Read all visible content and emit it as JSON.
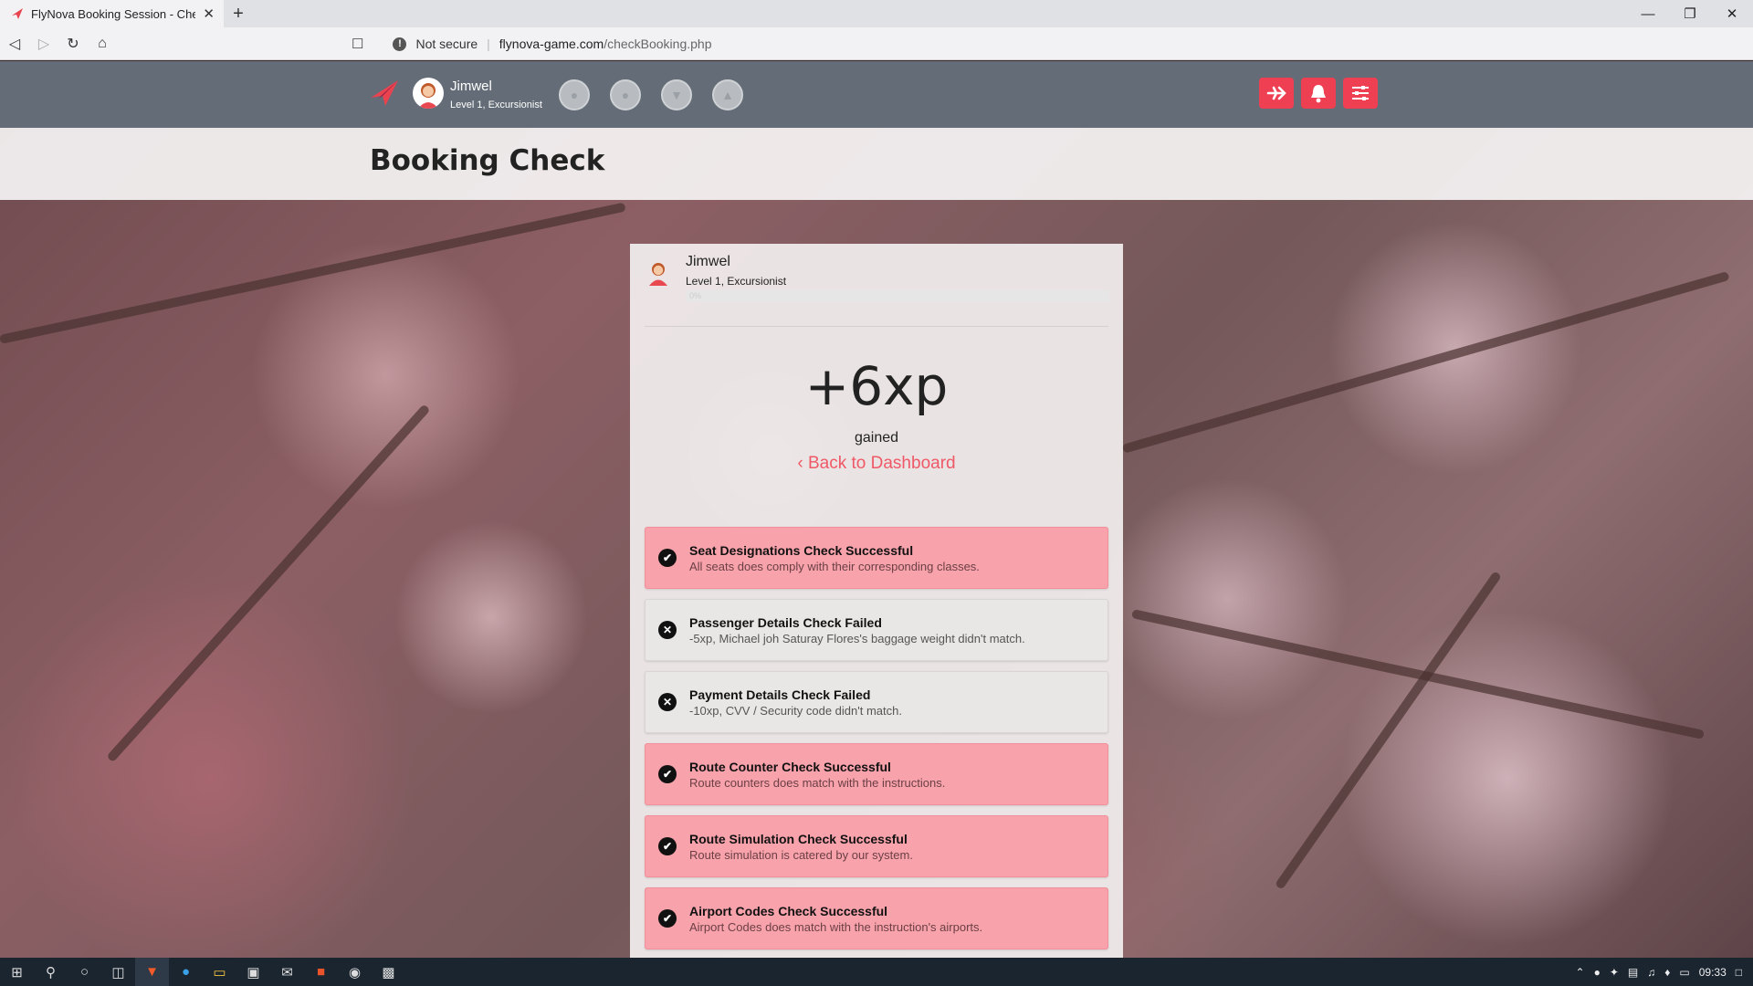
{
  "browser": {
    "tab_title": "FlyNova Booking Session - Check",
    "tab_close": "✕",
    "new_tab": "+",
    "security_label": "Not secure",
    "url_host": "flynova-game.com",
    "url_path": "/checkBooking.php"
  },
  "header": {
    "user_name": "Jimwel",
    "user_level": "Level 1, Excursionist"
  },
  "title": "Booking Check",
  "card": {
    "user_name": "Jimwel",
    "user_level": "Level 1, Excursionist",
    "progress_text": "0%",
    "progress_value": 0,
    "xp": "+6xp",
    "gained": "gained",
    "back_link": "Back to Dashboard",
    "checks": [
      {
        "status": "success",
        "title": "Seat Designations Check Successful",
        "desc": "All seats does comply with their corresponding classes."
      },
      {
        "status": "failed",
        "title": "Passenger Details Check Failed",
        "desc": "-5xp, Michael joh Saturay Flores's baggage weight didn't match."
      },
      {
        "status": "failed",
        "title": "Payment Details Check Failed",
        "desc": "-10xp, CVV / Security code didn't match."
      },
      {
        "status": "success",
        "title": "Route Counter Check Successful",
        "desc": "Route counters does match with the instructions."
      },
      {
        "status": "success",
        "title": "Route Simulation Check Successful",
        "desc": "Route simulation is catered by our system."
      },
      {
        "status": "success",
        "title": "Airport Codes Check Successful",
        "desc": "Airport Codes does match with the instruction's airports."
      }
    ]
  },
  "taskbar": {
    "clock": "09:33"
  },
  "colors": {
    "accent": "#ef3f52",
    "header_bg": "#646d77",
    "success_bg": "#f8a2ab",
    "failed_bg": "#e9e7e6"
  }
}
